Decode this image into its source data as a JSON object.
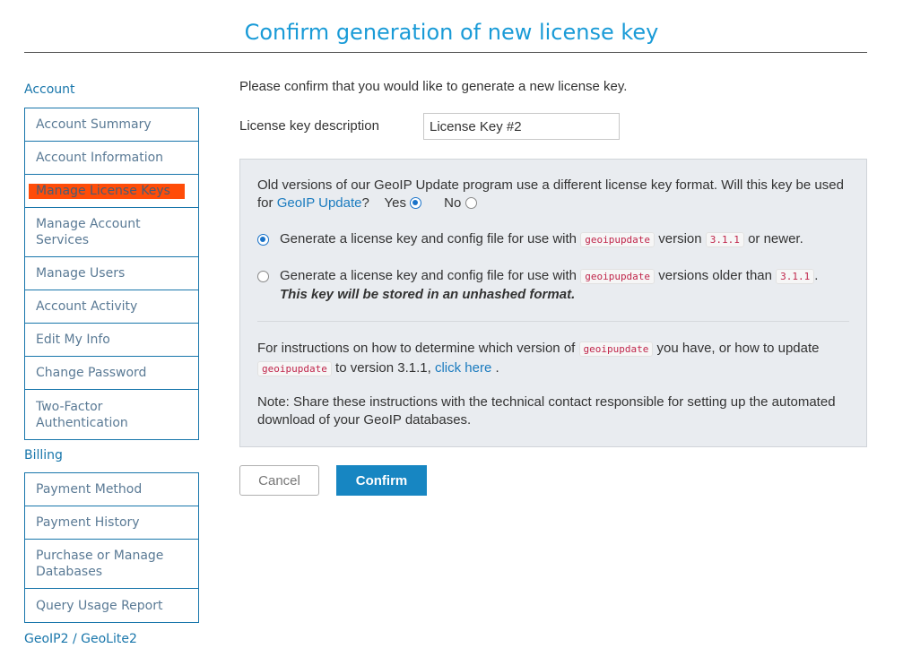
{
  "page": {
    "title": "Confirm generation of new license key"
  },
  "sidebar": {
    "account_heading": "Account",
    "account_items": [
      "Account Summary",
      "Account Information",
      "Manage License Keys",
      "Manage Account Services",
      "Manage Users",
      "Account Activity",
      "Edit My Info",
      "Change Password",
      "Two-Factor Authentication"
    ],
    "billing_heading": "Billing",
    "billing_items": [
      "Payment Method",
      "Payment History",
      "Purchase or Manage Databases",
      "Query Usage Report"
    ],
    "geoip_heading": "GeoIP2 / GeoLite2"
  },
  "main": {
    "intro": "Please confirm that you would like to generate a new license key.",
    "description_label": "License key description",
    "description_value": "License Key #2",
    "question_text": "Old versions of our GeoIP Update program use a different license key format. Will this key be used for",
    "question_link": "GeoIP Update",
    "question_mark": "?",
    "yes_label": "Yes",
    "no_label": "No",
    "option1_prefix": "Generate a license key and config file for use with",
    "option1_code": "geoipupdate",
    "option1_mid": "version",
    "option1_version": "3.1.1",
    "option1_suffix": "or newer.",
    "option2_prefix": "Generate a license key and config file for use with",
    "option2_code": "geoipupdate",
    "option2_mid": "versions older than",
    "option2_version": "3.1.1",
    "option2_suffix": ".",
    "option2_warning": "This key will be stored in an unhashed format.",
    "instr_prefix": "For instructions on how to determine which version of",
    "instr_code1": "geoipupdate",
    "instr_mid": "you have, or how to update",
    "instr_code2": "geoipupdate",
    "instr_to": "to version 3.1.1,",
    "instr_link": "click here",
    "instr_end": ".",
    "note": "Note: Share these instructions with the technical contact responsible for setting up the automated download of your GeoIP databases.",
    "cancel_label": "Cancel",
    "confirm_label": "Confirm"
  },
  "colors": {
    "accent": "#1a9bd7",
    "highlight": "#ff4c08",
    "button": "#1786c2"
  }
}
